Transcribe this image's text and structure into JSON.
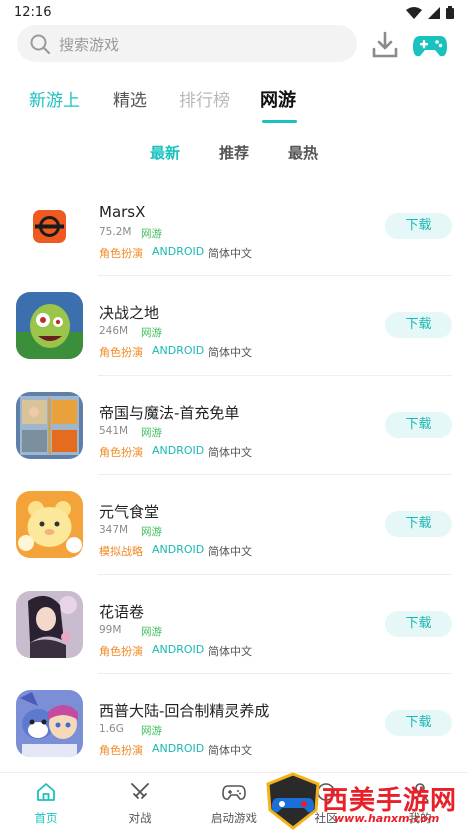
{
  "status_bar": {
    "time": "12:16"
  },
  "search": {
    "placeholder": "搜索游戏"
  },
  "top_tabs": [
    "新游上",
    "精选",
    "排行榜",
    "网游"
  ],
  "sub_tabs": [
    "最新",
    "推荐",
    "最热"
  ],
  "games": [
    {
      "name": "MarsX",
      "size": "75.2M",
      "tag": "网游",
      "genre": "角色扮演",
      "platform": "ANDROID",
      "lang": "简体中文",
      "button": "下载",
      "icon": "marsx-logo-icon"
    },
    {
      "name": "决战之地",
      "size": "246M",
      "tag": "网游",
      "genre": "角色扮演",
      "platform": "ANDROID",
      "lang": "简体中文",
      "button": "下载",
      "icon": "zombie-icon"
    },
    {
      "name": "帝国与魔法-首充免单",
      "size": "541M",
      "tag": "网游",
      "genre": "角色扮演",
      "platform": "ANDROID",
      "lang": "简体中文",
      "button": "下载",
      "icon": "puzzle-icon"
    },
    {
      "name": "元气食堂",
      "size": "347M",
      "tag": "网游",
      "genre": "模拟战略",
      "platform": "ANDROID",
      "lang": "简体中文",
      "button": "下载",
      "icon": "bear-icon"
    },
    {
      "name": "花语卷",
      "size": "99M",
      "tag": "网游",
      "genre": "角色扮演",
      "platform": "ANDROID",
      "lang": "简体中文",
      "button": "下载",
      "icon": "anime-girl-icon"
    },
    {
      "name": "西普大陆-回合制精灵养成",
      "size": "1.6G",
      "tag": "网游",
      "genre": "角色扮演",
      "platform": "ANDROID",
      "lang": "简体中文",
      "button": "下载",
      "icon": "fox-characters-icon"
    }
  ],
  "bottom_nav": [
    "首页",
    "对战",
    "启动游戏",
    "社区",
    "我的"
  ],
  "watermark": {
    "title": "西美手游网",
    "url": "www.hanxm.com"
  },
  "colors": {
    "accent": "#19c2be",
    "genre": "#f08a24",
    "online_tag": "#3fbf5a",
    "watermark": "#e8202a"
  }
}
